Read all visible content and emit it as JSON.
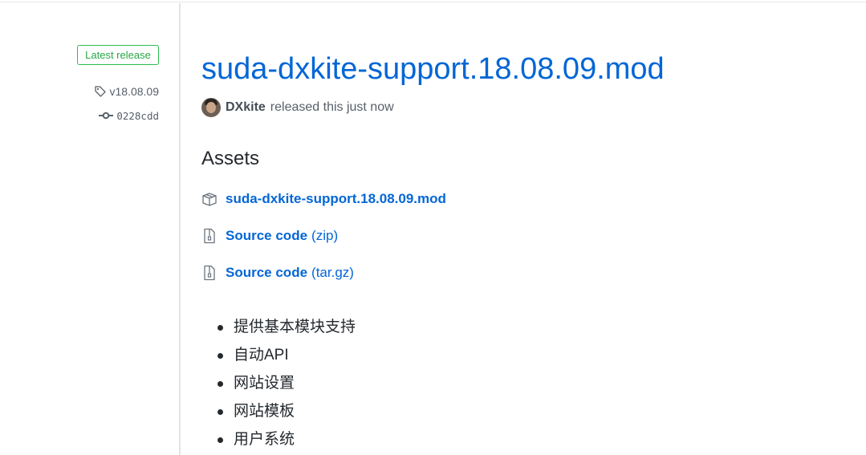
{
  "sidebar": {
    "badge": "Latest release",
    "tag": "v18.08.09",
    "commit": "0228cdd"
  },
  "release": {
    "title": "suda-dxkite-support.18.08.09.mod",
    "author": "DXkite",
    "byline_suffix": "released this just now"
  },
  "assets": {
    "heading": "Assets",
    "items": [
      {
        "icon": "package-icon",
        "name": "suda-dxkite-support.18.08.09.mod",
        "ext": ""
      },
      {
        "icon": "file-zip-icon",
        "name": "Source code",
        "ext": "(zip)"
      },
      {
        "icon": "file-zip-icon",
        "name": "Source code",
        "ext": "(tar.gz)"
      }
    ]
  },
  "notes": [
    "提供基本模块支持",
    "自动API",
    "网站设置",
    "网站模板",
    "用户系统"
  ],
  "colors": {
    "link": "#0366d6",
    "badge_green": "#28a745",
    "muted": "#586069"
  }
}
